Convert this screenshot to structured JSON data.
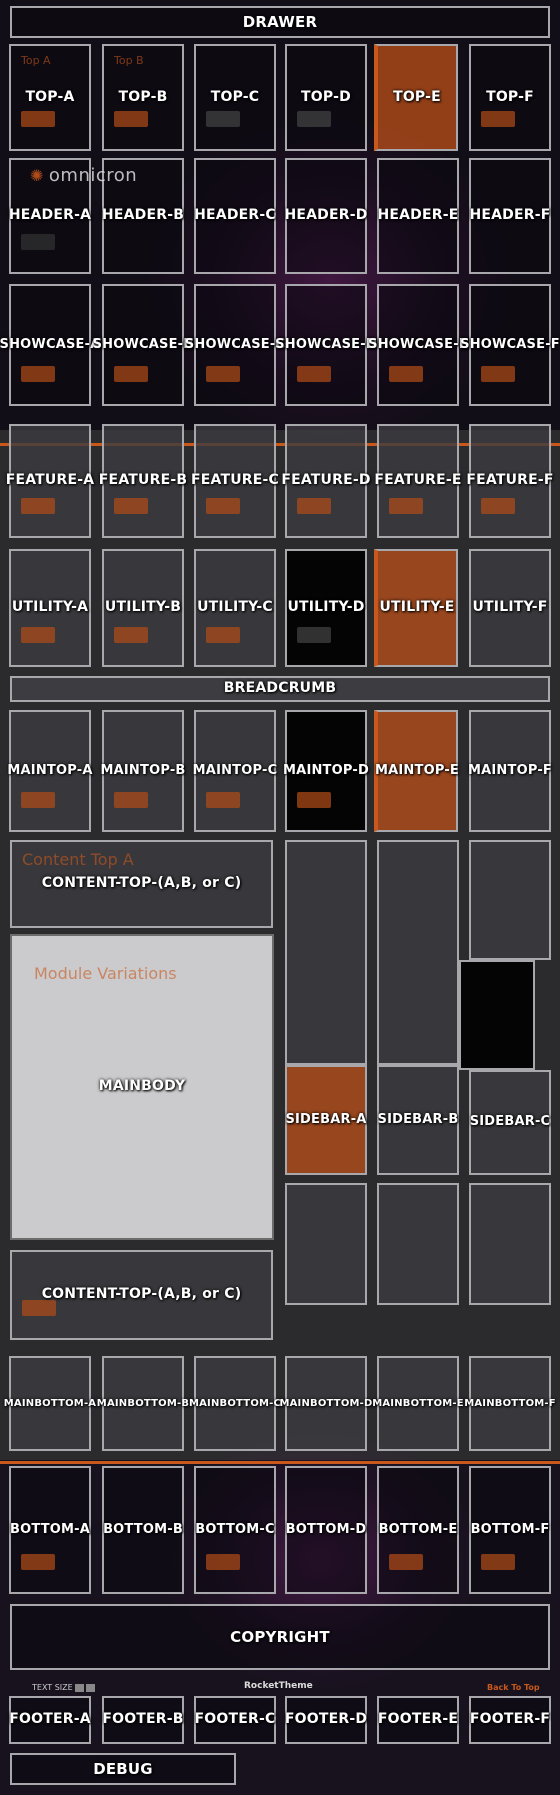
{
  "drawer": {
    "label": "DRAWER"
  },
  "top": [
    "TOP-A",
    "TOP-B",
    "TOP-C",
    "TOP-D",
    "TOP-E",
    "TOP-F"
  ],
  "header": [
    "HEADER-A",
    "HEADER-B",
    "HEADER-C",
    "HEADER-D",
    "HEADER-E",
    "HEADER-F"
  ],
  "showcase": [
    "SHOWCASE-A",
    "SHOWCASE-B",
    "SHOWCASE-C",
    "SHOWCASE-D",
    "SHOWCASE-E",
    "SHOWCASE-F"
  ],
  "feature": [
    "FEATURE-A",
    "FEATURE-B",
    "FEATURE-C",
    "FEATURE-D",
    "FEATURE-E",
    "FEATURE-F"
  ],
  "utility": [
    "UTILITY-A",
    "UTILITY-B",
    "UTILITY-C",
    "UTILITY-D",
    "UTILITY-E",
    "UTILITY-F"
  ],
  "breadcrumb": {
    "label": "BREADCRUMB"
  },
  "maintop": [
    "MAINTOP-A",
    "MAINTOP-B",
    "MAINTOP-C",
    "MAINTOP-D",
    "MAINTOP-E",
    "MAINTOP-F"
  ],
  "content_top": {
    "label": "CONTENT-TOP-(A,B, or C)"
  },
  "mainbody": {
    "label": "MAINBODY"
  },
  "sidebar": [
    "SIDEBAR-A",
    "SIDEBAR-B",
    "SIDEBAR-C"
  ],
  "content_bottom": {
    "label": "CONTENT-TOP-(A,B, or C)"
  },
  "mainbottom": [
    "MAINBOTTOM-A",
    "MAINBOTTOM-B",
    "MAINBOTTOM-C",
    "MAINBOTTOM-D",
    "MAINBOTTOM-E",
    "MAINBOTTOM-F"
  ],
  "bottom": [
    "BOTTOM-A",
    "BOTTOM-B",
    "BOTTOM-C",
    "BOTTOM-D",
    "BOTTOM-E",
    "BOTTOM-F"
  ],
  "copyright": {
    "label": "COPYRIGHT"
  },
  "footer": [
    "FOOTER-A",
    "FOOTER-B",
    "FOOTER-C",
    "FOOTER-D",
    "FOOTER-E",
    "FOOTER-F"
  ],
  "debug": {
    "label": "DEBUG"
  },
  "logo": {
    "text": "omnicron"
  },
  "toolbar": {
    "text_size": "TEXT SIZE",
    "brand": "RocketTheme",
    "back_to_top": "Back To Top"
  },
  "colors": {
    "accent": "#c8581c",
    "border": "#a7a7ac",
    "background": "#17121d"
  }
}
